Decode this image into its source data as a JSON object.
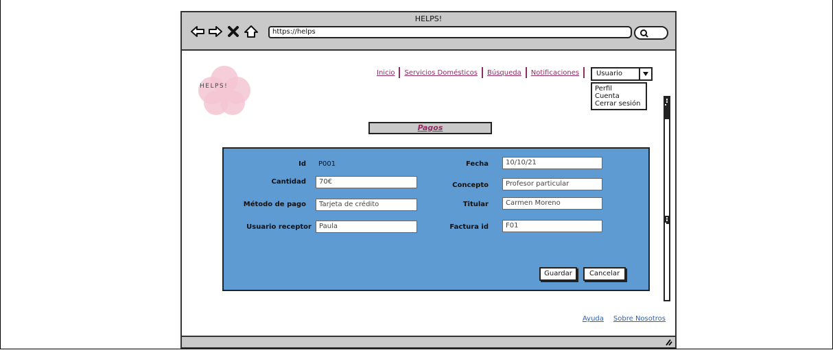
{
  "window": {
    "title": "HELPS!",
    "url": "https://helps"
  },
  "logo": {
    "text": "HELPS!"
  },
  "nav": {
    "links": [
      "Inicio",
      "Servicios Domésticos",
      "Búsqueda",
      "Notificaciones"
    ],
    "link_color": "#8e2c62"
  },
  "user": {
    "selected": "Usuario",
    "options": [
      "Perfil",
      "Cuenta",
      "Cerrar sesión"
    ]
  },
  "page": {
    "title": "Pagos"
  },
  "form": {
    "panel_color": "#5e9bd3",
    "id_label": "Id",
    "id_value": "P001",
    "fecha_label": "Fecha",
    "fecha_value": "10/10/21",
    "cantidad_label": "Cantidad",
    "cantidad_value": "70€",
    "concepto_label": "Concepto",
    "concepto_value": "Profesor particular",
    "metodo_label": "Método de pago",
    "metodo_value": "Tarjeta de crédito",
    "titular_label": "Titular",
    "titular_value": "Carmen Moreno",
    "receptor_label": "Usuario receptor",
    "receptor_value": "Paula",
    "factura_label": "Factura id",
    "factura_value": "F01",
    "save_label": "Guardar",
    "cancel_label": "Cancelar"
  },
  "footer": {
    "help": "Ayuda",
    "about": "Sobre Nosotros"
  },
  "icons": [
    "back-arrow-icon",
    "forward-arrow-icon",
    "close-icon",
    "home-icon",
    "search-icon",
    "chevron-down-icon",
    "resize-grip-icon"
  ]
}
